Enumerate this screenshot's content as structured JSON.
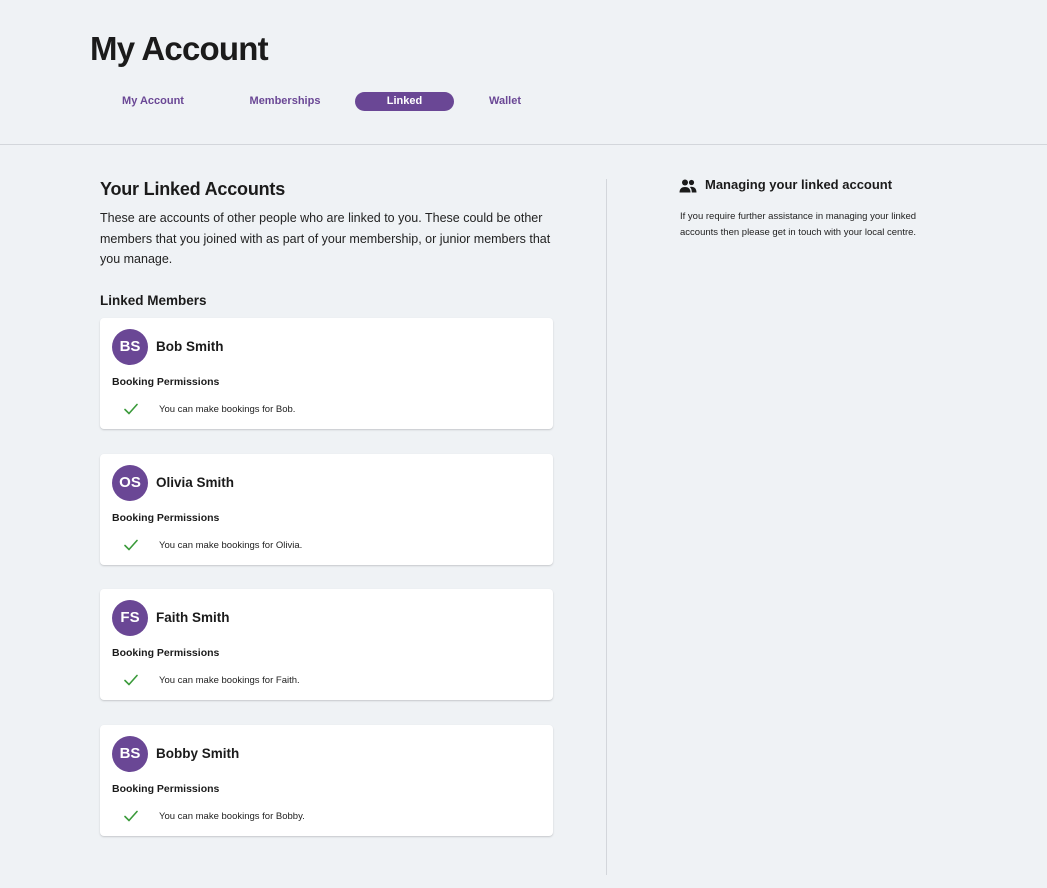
{
  "header": {
    "title": "My Account",
    "tabs": [
      {
        "label": "My Account",
        "active": false
      },
      {
        "label": "Memberships",
        "active": false
      },
      {
        "label": "Linked",
        "active": true
      },
      {
        "label": "Wallet",
        "active": false
      }
    ]
  },
  "main": {
    "title": "Your Linked Accounts",
    "description": "These are accounts of other people who are linked to you. These could be other members that you joined with as part of your membership, or junior members that you manage.",
    "members_heading": "Linked Members",
    "members": [
      {
        "initials": "BS",
        "name": "Bob Smith",
        "permissions_heading": "Booking Permissions",
        "permission": "You can make bookings for Bob."
      },
      {
        "initials": "OS",
        "name": "Olivia Smith",
        "permissions_heading": "Booking Permissions",
        "permission": "You can make bookings for Olivia."
      },
      {
        "initials": "FS",
        "name": "Faith Smith",
        "permissions_heading": "Booking Permissions",
        "permission": "You can make bookings for Faith."
      },
      {
        "initials": "BS",
        "name": "Bobby Smith",
        "permissions_heading": "Booking Permissions",
        "permission": "You can make bookings for Bobby."
      }
    ]
  },
  "sidebar": {
    "icon": "people-icon",
    "title": "Managing your linked account",
    "description": "If you require further assistance in managing your linked accounts then please get in touch with your local centre."
  },
  "colors": {
    "accent": "#6a4795",
    "background": "#eff2f5",
    "check": "#3a9a3a"
  }
}
